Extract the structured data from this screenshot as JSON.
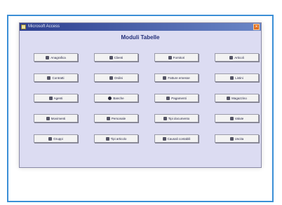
{
  "window": {
    "title": "Microsoft Access",
    "heading": "Moduli Tabelle",
    "close_glyph": "×"
  },
  "buttons": [
    {
      "label": "Anagrafica",
      "icon": "table-icon"
    },
    {
      "label": "Clienti",
      "icon": "form-icon"
    },
    {
      "label": "Fornitori",
      "icon": "search-icon"
    },
    {
      "label": "Articoli",
      "icon": "report-icon"
    },
    {
      "label": "Contratti",
      "icon": "phone-icon"
    },
    {
      "label": "Ordini",
      "icon": "form-icon"
    },
    {
      "label": "Fatture emesse",
      "icon": "database-icon"
    },
    {
      "label": "Listini",
      "icon": "form-icon"
    },
    {
      "label": "Agenti",
      "icon": "person-icon"
    },
    {
      "label": "Banche",
      "icon": "circle-icon"
    },
    {
      "label": "Pagamenti",
      "icon": "form-icon"
    },
    {
      "label": "Magazzino",
      "icon": "form-icon"
    },
    {
      "label": "Movimenti",
      "icon": "arrows-icon"
    },
    {
      "label": "Personale",
      "icon": "form-icon"
    },
    {
      "label": "Tipi documento",
      "icon": "form-icon"
    },
    {
      "label": "Valute",
      "icon": "gear-icon"
    },
    {
      "label": "Gruppi",
      "icon": "group-icon"
    },
    {
      "label": "Tipi articolo",
      "icon": "list-icon"
    },
    {
      "label": "Causali contabili",
      "icon": "form-icon"
    },
    {
      "label": "Uscita",
      "icon": "door-icon"
    }
  ]
}
